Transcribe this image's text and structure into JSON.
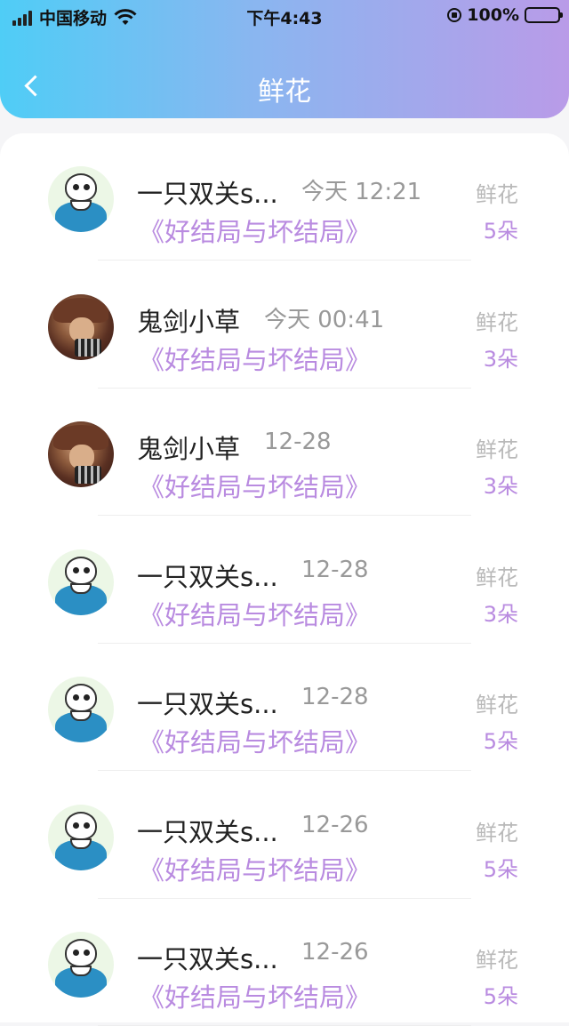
{
  "status_bar": {
    "carrier": "中国移动",
    "time": "下午4:43",
    "battery": "100%"
  },
  "header": {
    "title": "鲜花"
  },
  "colors": {
    "accent": "#b98be0",
    "header_gradient_start": "#4fcdf6",
    "header_gradient_end": "#b99be8",
    "battery": "#f8c400"
  },
  "records": [
    {
      "avatar": "sans-avatar",
      "name": "一只双关s...",
      "time": "今天 12:21",
      "book": "《好结局与坏结局》",
      "gift_label": "鲜花",
      "count": "5朵"
    },
    {
      "avatar": "hunter-avatar",
      "name": "鬼剑小草",
      "time": "今天 00:41",
      "book": "《好结局与坏结局》",
      "gift_label": "鲜花",
      "count": "3朵"
    },
    {
      "avatar": "hunter-avatar",
      "name": "鬼剑小草",
      "time": "12-28",
      "book": "《好结局与坏结局》",
      "gift_label": "鲜花",
      "count": "3朵"
    },
    {
      "avatar": "sans-avatar",
      "name": "一只双关s...",
      "time": "12-28",
      "book": "《好结局与坏结局》",
      "gift_label": "鲜花",
      "count": "3朵"
    },
    {
      "avatar": "sans-avatar",
      "name": "一只双关s...",
      "time": "12-28",
      "book": "《好结局与坏结局》",
      "gift_label": "鲜花",
      "count": "5朵"
    },
    {
      "avatar": "sans-avatar",
      "name": "一只双关s...",
      "time": "12-26",
      "book": "《好结局与坏结局》",
      "gift_label": "鲜花",
      "count": "5朵"
    },
    {
      "avatar": "sans-avatar",
      "name": "一只双关s...",
      "time": "12-26",
      "book": "《好结局与坏结局》",
      "gift_label": "鲜花",
      "count": "5朵"
    }
  ]
}
